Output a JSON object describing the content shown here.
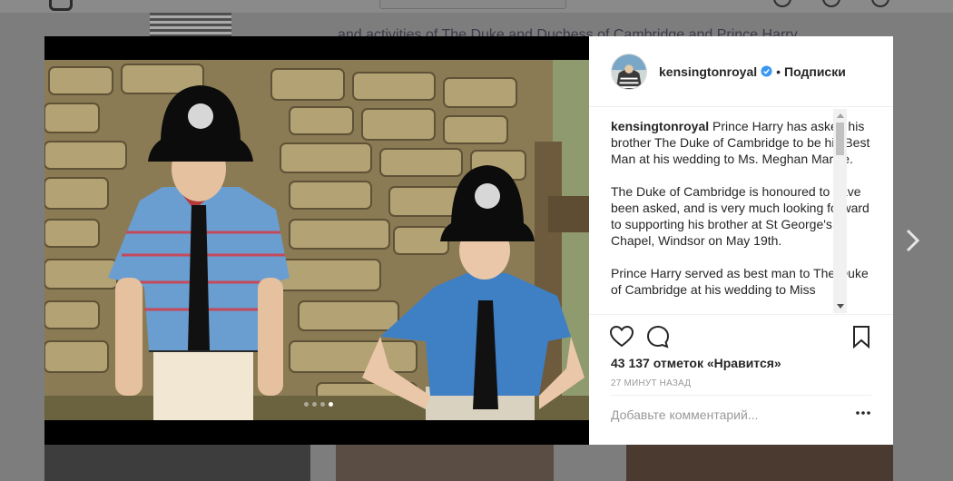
{
  "background_page": {
    "bio_text": "and activities of The Duke and Duchess of Cambridge and Prince Harry"
  },
  "post": {
    "username": "kensingtonroyal",
    "follow_label": "Подписки",
    "separator": "•",
    "caption_paragraphs": [
      "Prince Harry has asked his brother The Duke of Cambridge to be his Best Man at his wedding to Ms. Meghan Markle.",
      "The Duke of Cambridge is honoured to have been asked, and is very much looking forward to supporting his brother at St George's Chapel, Windsor on May 19th.",
      "Prince Harry served as best man to The Duke of Cambridge at his wedding to Miss"
    ],
    "likes": "43 137 отметок «Нравится»",
    "time_ago": "27 МИНУТ НАЗАД",
    "comment_placeholder": "Добавьте комментарий...",
    "carousel": {
      "count": 4,
      "active_index": 3
    }
  },
  "colors": {
    "verified_badge": "#3897f0",
    "text_primary": "#262626",
    "text_secondary": "#999999"
  },
  "icons": [
    "heart-icon",
    "comment-icon",
    "bookmark-icon",
    "more-options-icon",
    "verified-badge-icon",
    "chevron-right-icon"
  ]
}
